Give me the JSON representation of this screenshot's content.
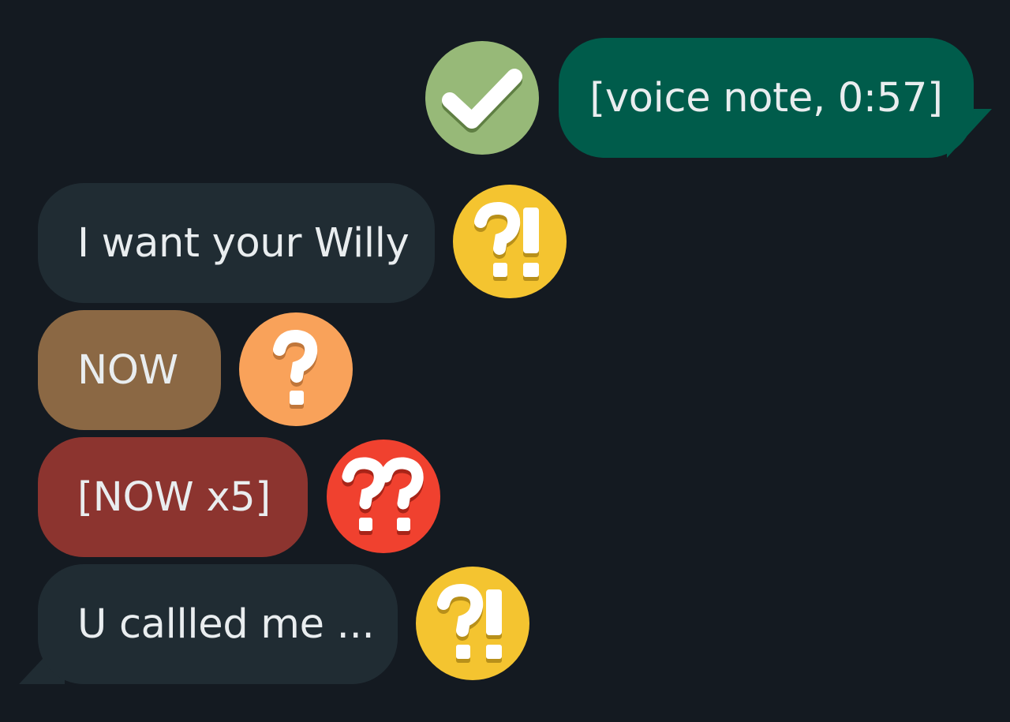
{
  "messages": [
    {
      "text": "[voice note, 0:57]",
      "direction": "outgoing",
      "color": "#005c4b",
      "reaction": {
        "icon": "checkmark-icon",
        "color": "#97b978"
      }
    },
    {
      "text": "I want your Willy",
      "direction": "incoming",
      "color": "#202c33",
      "reaction": {
        "icon": "interrobang-icon",
        "color": "#f4c430"
      }
    },
    {
      "text": "NOW",
      "direction": "incoming",
      "color": "#8b6844",
      "reaction": {
        "icon": "question-icon",
        "color": "#f9a25a"
      }
    },
    {
      "text": "[NOW x5]",
      "direction": "incoming",
      "color": "#8c342f",
      "reaction": {
        "icon": "double-question-icon",
        "color": "#f0412f"
      }
    },
    {
      "text": "U callled me ...",
      "direction": "incoming",
      "color": "#202c33",
      "reaction": {
        "icon": "interrobang-icon",
        "color": "#f4c430"
      }
    }
  ],
  "theme": {
    "background": "#141a21",
    "text_color": "#e9edef"
  }
}
